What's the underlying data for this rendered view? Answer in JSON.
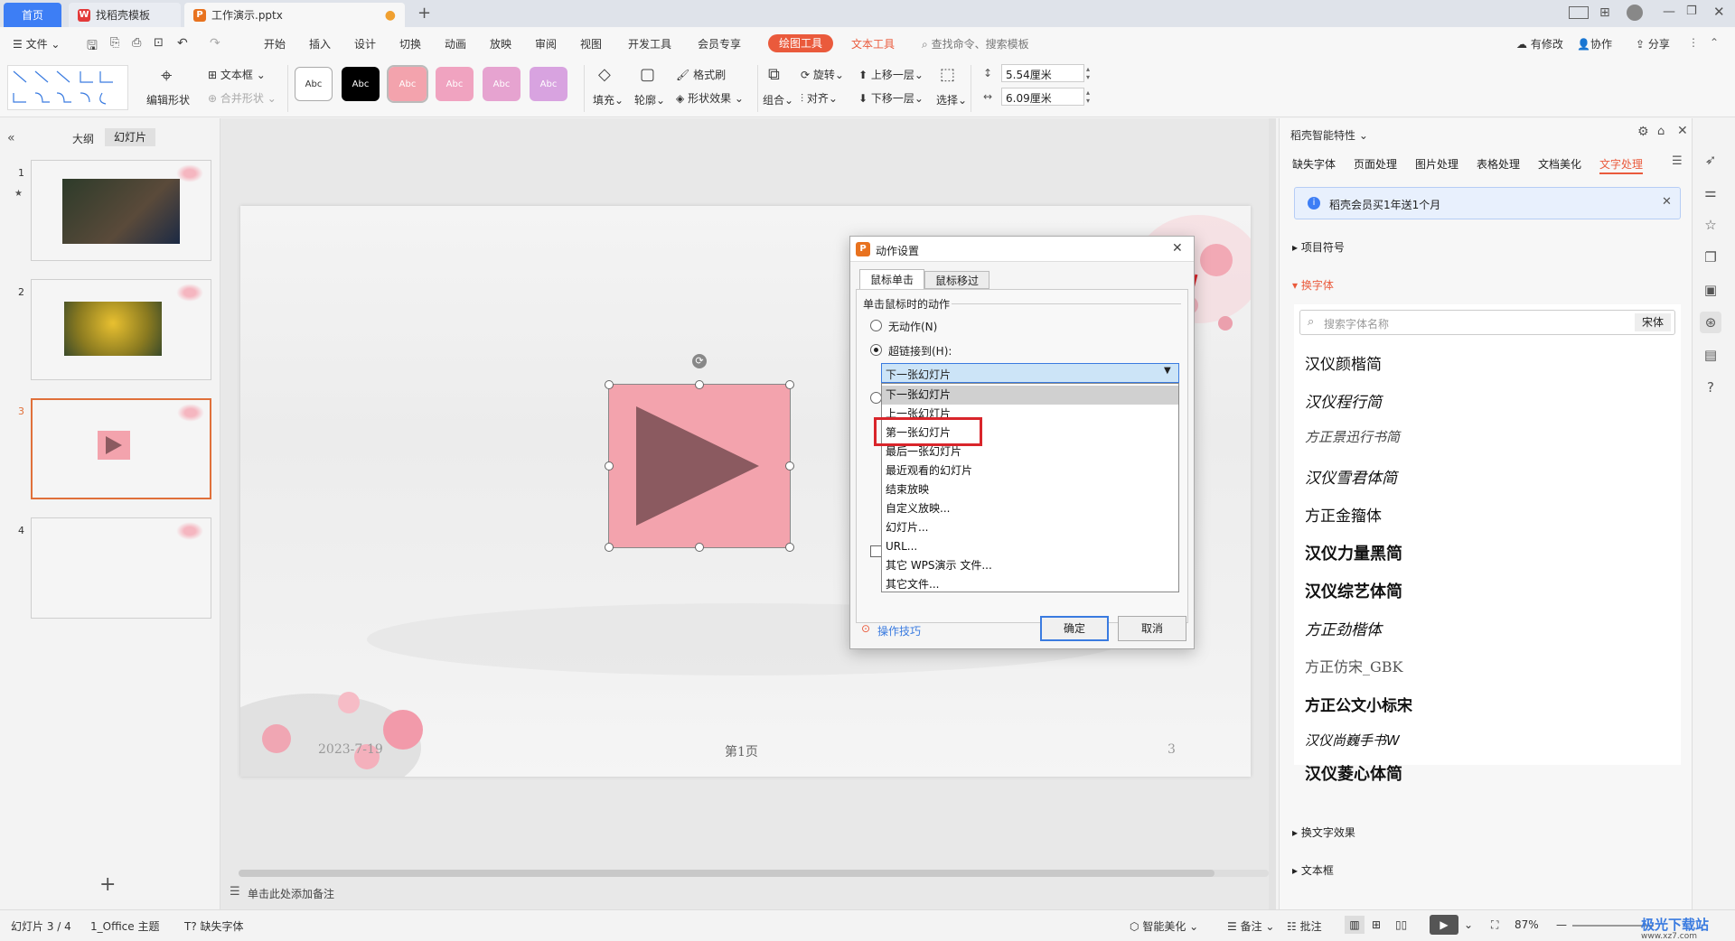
{
  "window_tabs": [
    {
      "label": "首页"
    },
    {
      "label": "找稻壳模板"
    },
    {
      "label": "工作演示.pptx"
    }
  ],
  "menu": {
    "file": "文件",
    "items": [
      "开始",
      "插入",
      "设计",
      "切换",
      "动画",
      "放映",
      "审阅",
      "视图",
      "开发工具",
      "会员专享"
    ],
    "drawing_tools": "绘图工具",
    "text_tools": "文本工具",
    "search": "查找命令、搜索模板",
    "right": [
      "有修改",
      "协作",
      "分享"
    ]
  },
  "ribbon": {
    "edit_shape": "编辑形状",
    "text_box": "文本框",
    "merge_shape": "合并形状",
    "style_swatches": [
      "Abc",
      "Abc",
      "Abc",
      "Abc",
      "Abc",
      "Abc"
    ],
    "fill": "填充",
    "outline": "轮廓",
    "format_painter": "格式刷",
    "shape_effect": "形状效果",
    "group": "组合",
    "rotate": "旋转",
    "align": "对齐",
    "bring_forward": "上移一层",
    "send_backward": "下移一层",
    "select": "选择",
    "height": "5.54厘米",
    "width": "6.09厘米"
  },
  "left_panel": {
    "tab_outline": "大纲",
    "tab_slides": "幻灯片",
    "slides": [
      "1",
      "2",
      "3",
      "4"
    ]
  },
  "slide": {
    "date": "2023-7-19",
    "page_text": "第1页",
    "page_num": "3"
  },
  "dialog": {
    "title": "动作设置",
    "tab_click": "鼠标单击",
    "tab_hover": "鼠标移过",
    "group_label": "单击鼠标时的动作",
    "no_action": "无动作(N)",
    "hyperlink": "超链接到(H):",
    "selected": "下一张幻灯片",
    "options": [
      "下一张幻灯片",
      "上一张幻灯片",
      "第一张幻灯片",
      "最后一张幻灯片",
      "最近观看的幻灯片",
      "结束放映",
      "自定义放映...",
      "幻灯片...",
      "URL...",
      "其它 WPS演示 文件...",
      "其它文件..."
    ],
    "tips": "操作技巧",
    "ok": "确定",
    "cancel": "取消"
  },
  "right_panel": {
    "header": "稻壳智能特性",
    "tabs": [
      "缺失字体",
      "页面处理",
      "图片处理",
      "表格处理",
      "文档美化",
      "文字处理"
    ],
    "promo": "稻壳会员买1年送1个月",
    "section_bullets": "项目符号",
    "section_font": "换字体",
    "search_placeholder": "搜索字体名称",
    "current_font": "宋体",
    "fonts": [
      "汉仪颜楷简",
      "汉仪程行简",
      "方正景迅行书简",
      "汉仪雪君体简",
      "方正金籀体",
      "汉仪力量黑简",
      "汉仪综艺体简",
      "方正劲楷体",
      "方正仿宋_GBK",
      "方正公文小标宋",
      "汉仪尚巍手书W",
      "汉仪菱心体简"
    ],
    "section_effect": "换文字效果",
    "section_textbox": "文本框"
  },
  "notes": "单击此处添加备注",
  "status": {
    "slide_index": "幻灯片 3 / 4",
    "theme": "1_Office 主题",
    "missing_font": "缺失字体",
    "beautify": "智能美化",
    "notes": "备注",
    "comments": "批注",
    "zoom": "87%"
  },
  "watermark": "极光下载站",
  "watermark_url": "www.xz7.com",
  "colors": {
    "accent": "#3d7ef5",
    "drawing_pill": "#ea5a3c",
    "selected_orange": "#e0703a",
    "shape_pink": "#f3a3ad",
    "play_triangle": "#8b5a60",
    "red_highlight": "#d9252b"
  }
}
